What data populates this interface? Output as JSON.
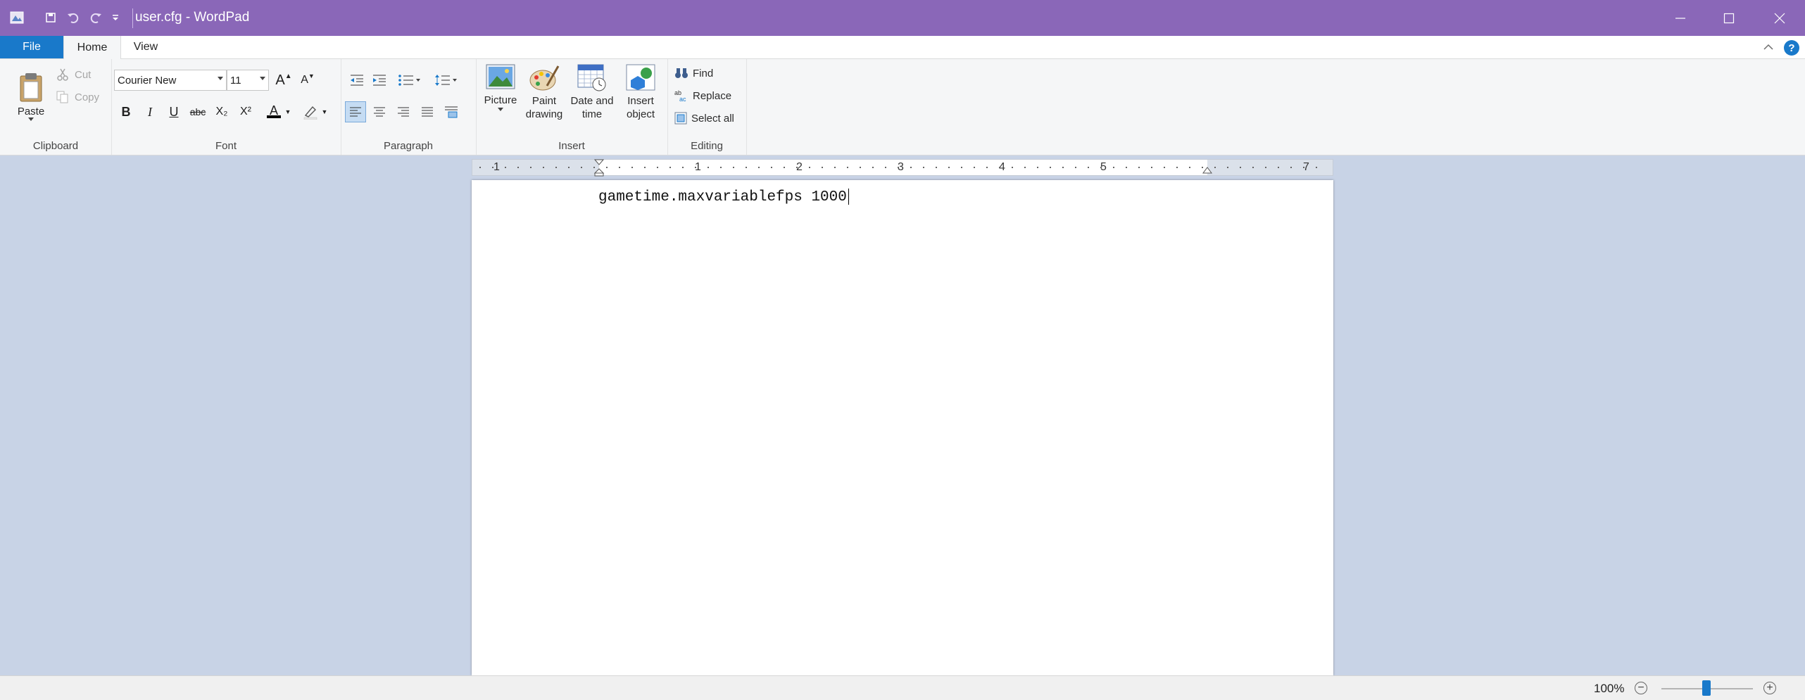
{
  "window": {
    "title": "user.cfg - WordPad",
    "quick_access": [
      "app-icon",
      "save-icon",
      "undo-icon",
      "redo-icon",
      "customize-qat-icon"
    ],
    "controls": [
      "minimize-icon",
      "maximize-icon",
      "close-icon"
    ],
    "title_bar_color": "#8a67b8"
  },
  "tabs": {
    "file": "File",
    "home": "Home",
    "view": "View"
  },
  "ribbon": {
    "clipboard": {
      "label": "Clipboard",
      "paste": "Paste",
      "cut": "Cut",
      "copy": "Copy"
    },
    "font": {
      "label": "Font",
      "family": "Courier New",
      "size": "11",
      "bold": "B",
      "italic": "I",
      "underline": "U",
      "strikethrough": "abc",
      "subscript": "X₂",
      "superscript": "X²",
      "grow": "A",
      "shrink": "A",
      "font_color": "A",
      "highlight_color": "#e6e6e6",
      "text_color_bar": "#000000"
    },
    "paragraph": {
      "label": "Paragraph"
    },
    "insert": {
      "label": "Insert",
      "picture": "Picture",
      "paint_line1": "Paint",
      "paint_line2": "drawing",
      "datetime_line1": "Date and",
      "datetime_line2": "time",
      "object_line1": "Insert",
      "object_line2": "object"
    },
    "editing": {
      "label": "Editing",
      "find": "Find",
      "replace": "Replace",
      "select_all": "Select all"
    }
  },
  "ruler": {
    "numbers": [
      "1",
      "1",
      "2",
      "3",
      "4",
      "5",
      "7"
    ]
  },
  "document": {
    "text": "gametime.maxvariablefps 1000"
  },
  "status": {
    "zoom": "100%",
    "zoom_out": "−",
    "zoom_in": "+",
    "zoom_value": 100
  },
  "accent_color": "#1979ca"
}
